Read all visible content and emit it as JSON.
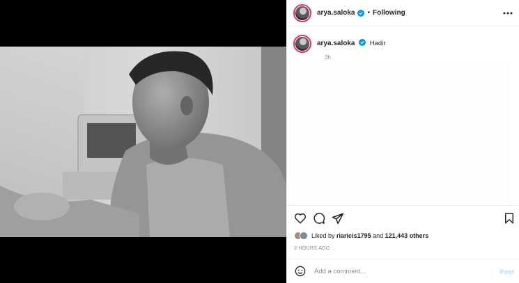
{
  "post": {
    "username": "arya.saloka",
    "separator": "•",
    "follow_status": "Following",
    "verified_icon": "verified-badge-icon",
    "more_icon": "more-horizontal-icon"
  },
  "caption": {
    "username": "arya.saloka",
    "text": "Hadir",
    "time": "3h"
  },
  "actions": {
    "like_icon": "heart-icon",
    "comment_icon": "comment-icon",
    "share_icon": "send-icon",
    "save_icon": "bookmark-icon"
  },
  "likes": {
    "prefix": "Liked by",
    "user": "riaricis1795",
    "middle": "and",
    "count": "121,443 others"
  },
  "timestamp": "3 HOURS AGO",
  "comment": {
    "placeholder": "Add a comment...",
    "post_label": "Post",
    "emoji_icon": "emoji-icon"
  },
  "colors": {
    "accent_blue": "#0095f6",
    "post_disabled": "#b3dbff",
    "story_ring": "#e1306c"
  }
}
